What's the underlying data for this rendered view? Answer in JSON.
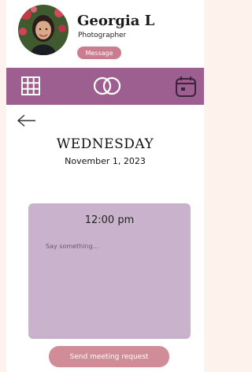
{
  "profile": {
    "name": "Georgia L",
    "role": "Photographer",
    "message_label": "Message"
  },
  "navbar": {
    "icons": [
      "grid-icon",
      "rings-icon",
      "calendar-icon"
    ]
  },
  "colors": {
    "navbar": "#9c5f8f",
    "card": "#c9b3cc",
    "button": "#d08d97",
    "message_button": "#c97d8e",
    "page_bg": "#fdf3ec"
  },
  "schedule": {
    "day": "WEDNESDAY",
    "date": "November 1, 2023"
  },
  "meeting": {
    "time": "12:00 pm",
    "note_placeholder": "Say something...",
    "send_label": "Send meeting request"
  }
}
